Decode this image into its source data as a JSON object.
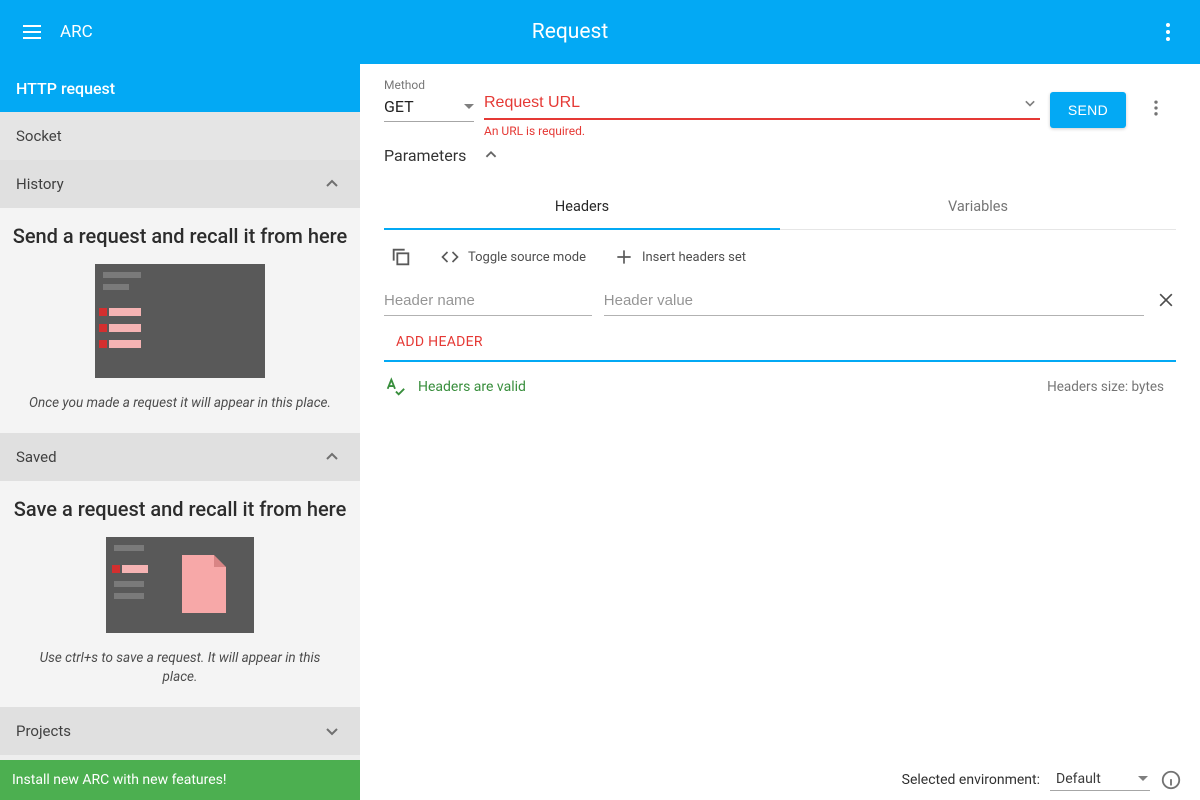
{
  "app_name": "ARC",
  "page_title": "Request",
  "sidebar": {
    "http_request": "HTTP request",
    "socket": "Socket",
    "history": "History",
    "history_empty_title": "Send a request and recall it from here",
    "history_empty_desc": "Once you made a request it will appear in this place.",
    "saved": "Saved",
    "saved_empty_title": "Save a request and recall it from here",
    "saved_empty_desc": "Use ctrl+s to save a request. It will appear in this place.",
    "projects": "Projects",
    "install_banner": "Install new ARC with new features!"
  },
  "request": {
    "method_label": "Method",
    "method_value": "GET",
    "url_placeholder": "Request URL",
    "url_error": "An URL is required.",
    "send_label": "SEND",
    "parameters_label": "Parameters"
  },
  "tabs": {
    "headers": "Headers",
    "variables": "Variables"
  },
  "toolbar": {
    "toggle_source": "Toggle source mode",
    "insert_set": "Insert headers set"
  },
  "headers": {
    "name_placeholder": "Header name",
    "value_placeholder": "Header value",
    "add_label": "ADD HEADER",
    "valid_msg": "Headers are valid",
    "size_prefix": "Headers size:",
    "size_unit": "bytes"
  },
  "footer": {
    "env_label": "Selected environment:",
    "env_value": "Default"
  }
}
